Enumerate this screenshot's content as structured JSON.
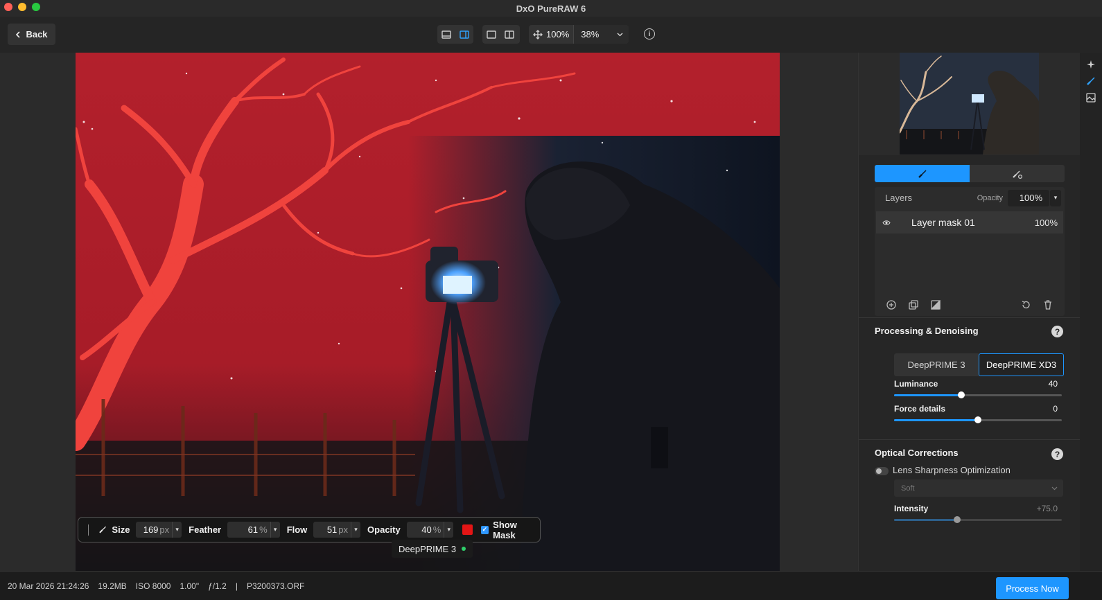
{
  "window": {
    "title": "DxO PureRAW 6"
  },
  "toolbar": {
    "back_label": "Back",
    "zoom_fit_label": "100%",
    "zoom_select_value": "38%"
  },
  "brush_bar": {
    "size_label": "Size",
    "size_value": "169",
    "size_unit": "px",
    "feather_label": "Feather",
    "feather_value": "61",
    "feather_unit": "%",
    "flow_label": "Flow",
    "flow_value": "51",
    "flow_unit": "px",
    "opacity_label": "Opacity",
    "opacity_value": "40",
    "opacity_unit": "%",
    "mask_color": "#e31515",
    "show_mask_label": "Show Mask",
    "show_mask_checked": true
  },
  "engine_badge": {
    "label": "DeepPRIME 3",
    "status_color": "#2fd06b"
  },
  "layers": {
    "title": "Layers",
    "opacity_label": "Opacity",
    "opacity_value": "100%",
    "items": [
      {
        "name": "Layer mask 01",
        "opacity": "100%",
        "visible": true
      }
    ]
  },
  "processing": {
    "title": "Processing & Denoising",
    "engines": [
      "DeepPRIME 3",
      "DeepPRIME XD3"
    ],
    "selected_engine": "DeepPRIME XD3",
    "luminance_label": "Luminance",
    "luminance_value": "40",
    "force_details_label": "Force details",
    "force_details_value": "0"
  },
  "optical": {
    "title": "Optical Corrections",
    "lens_sharpness_label": "Lens Sharpness Optimization",
    "lens_sharpness_enabled": false,
    "preset_value": "Soft",
    "intensity_label": "Intensity",
    "intensity_value": "+75.0"
  },
  "status": {
    "date": "20 Mar 2026 21:24:26",
    "size": "19.2MB",
    "iso": "ISO 8000",
    "shutter": "1.00\"",
    "aperture": "ƒ/1.2",
    "separator": "|",
    "filename": "P3200373.ORF"
  },
  "actions": {
    "process_label": "Process Now"
  },
  "colors": {
    "accent": "#1d96ff",
    "mask_overlay": "#c41e2a"
  }
}
